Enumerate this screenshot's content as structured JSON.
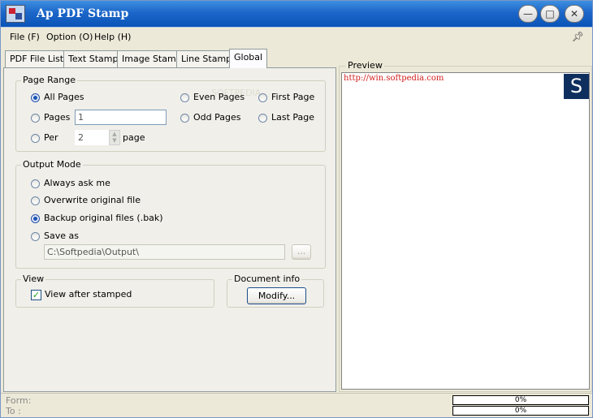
{
  "window": {
    "title": "Ap PDF Stamp",
    "minimize_label": "—",
    "maximize_label": "□",
    "close_label": "✕"
  },
  "menu": {
    "file": "File (F)",
    "option": "Option (O)",
    "help": "Help (H)",
    "pin_icon": "pin-icon"
  },
  "tabs": [
    "PDF File List",
    "Text Stamp",
    "Image Stamp",
    "Line Stamp",
    "Global"
  ],
  "active_tab": "Global",
  "page_range": {
    "legend": "Page Range",
    "all_pages": "All Pages",
    "pages": "Pages",
    "pages_value": "1",
    "per": "Per",
    "per_value": "2",
    "page_suffix": "page",
    "even_pages": "Even Pages",
    "odd_pages": "Odd Pages",
    "first_page": "First Page",
    "last_page": "Last Page",
    "selected": "All Pages"
  },
  "output_mode": {
    "legend": "Output Mode",
    "always_ask": "Always ask me",
    "overwrite": "Overwrite original file",
    "backup": "Backup original files (.bak)",
    "save_as": "Save as",
    "save_as_path": "C:\\Softpedia\\Output\\",
    "browse_label": "...",
    "selected": "Backup original files (.bak)"
  },
  "view": {
    "legend": "View",
    "view_after_stamped": "View after stamped",
    "checked": true
  },
  "document_info": {
    "legend": "Document info",
    "modify_label": "Modify..."
  },
  "preview": {
    "legend": "Preview",
    "url_text": "http://win.softpedia.com",
    "logo_letter": "S"
  },
  "status": {
    "form_label": "Form:",
    "to_label": "To  :",
    "progress_1": "0%",
    "progress_2": "0%"
  },
  "colors": {
    "titlebar": "#0a54b8",
    "preview_url": "#d21d1d",
    "logo_bg": "#0e2f5e"
  }
}
